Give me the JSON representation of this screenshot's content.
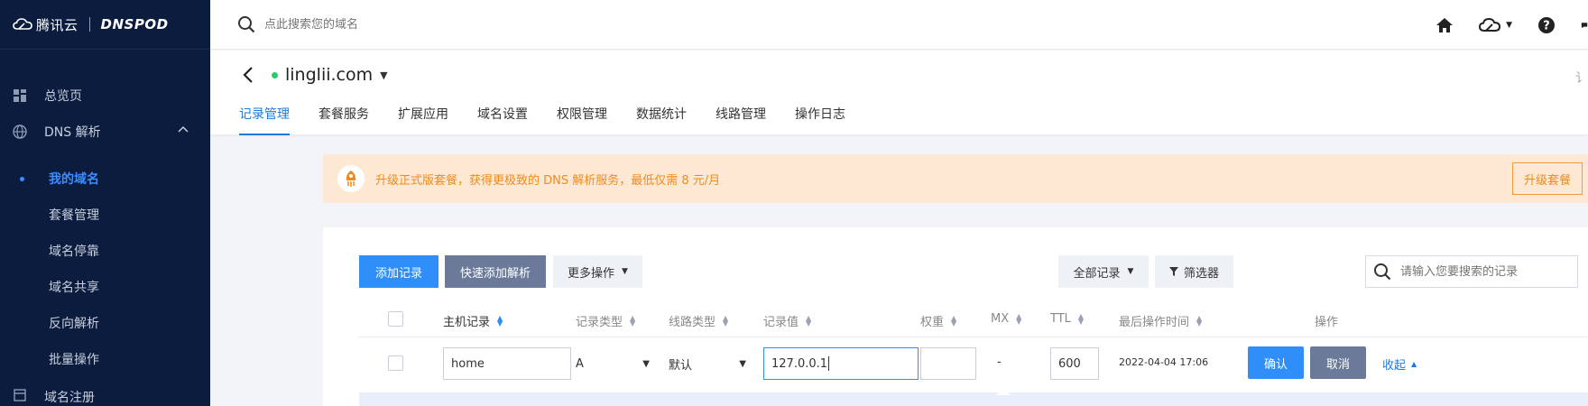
{
  "brand": {
    "logo_text": "腾讯云",
    "product": "DNSPOD"
  },
  "sidebar": {
    "items": [
      {
        "label": "总览页",
        "icon": "dashboard-icon"
      },
      {
        "label": "DNS 解析",
        "icon": "globe-icon",
        "expanded": true
      }
    ],
    "sub_items": [
      {
        "label": "我的域名",
        "active": true
      },
      {
        "label": "套餐管理"
      },
      {
        "label": "域名停靠"
      },
      {
        "label": "域名共享"
      },
      {
        "label": "反向解析"
      },
      {
        "label": "批量操作"
      }
    ],
    "bottom_item": {
      "label": "域名注册",
      "icon": "register-icon"
    }
  },
  "topbar": {
    "search_placeholder": "点此搜索您的域名",
    "icons": [
      "home-icon",
      "cloud-icon",
      "help-icon"
    ]
  },
  "header": {
    "domain": "linglii.com",
    "status_color": "#29cc6a",
    "right_cut_text": "讠",
    "tabs": [
      {
        "label": "记录管理",
        "active": true
      },
      {
        "label": "套餐服务"
      },
      {
        "label": "扩展应用"
      },
      {
        "label": "域名设置"
      },
      {
        "label": "权限管理"
      },
      {
        "label": "数据统计"
      },
      {
        "label": "线路管理"
      },
      {
        "label": "操作日志"
      }
    ]
  },
  "banner": {
    "text": "升级正式版套餐，获得更极致的 DNS 解析服务，最低仅需 8 元/月",
    "button": "升级套餐",
    "color": "#f08a1c"
  },
  "toolbar": {
    "add_record": "添加记录",
    "quick_add": "快速添加解析",
    "more_actions": "更多操作",
    "all_records": "全部记录",
    "filter": "筛选器",
    "search_placeholder": "请输入您要搜索的记录"
  },
  "table": {
    "headers": {
      "host": "主机记录",
      "type": "记录类型",
      "line": "线路类型",
      "value": "记录值",
      "weight": "权重",
      "mx": "MX",
      "ttl": "TTL",
      "last_op": "最后操作时间",
      "actions": "操作"
    },
    "edit_row": {
      "host": "home",
      "type": "A",
      "line": "默认",
      "value": "127.0.0.1",
      "weight": "",
      "mx": "-",
      "ttl": "600",
      "last_op": "2022-04-04 17:06",
      "confirm": "确认",
      "cancel": "取消",
      "collapse": "收起"
    }
  },
  "colors": {
    "sidebar_bg": "#0c1c3f",
    "primary": "#2f8ef7",
    "slate": "#6b7a99",
    "link": "#1f7ae0"
  }
}
